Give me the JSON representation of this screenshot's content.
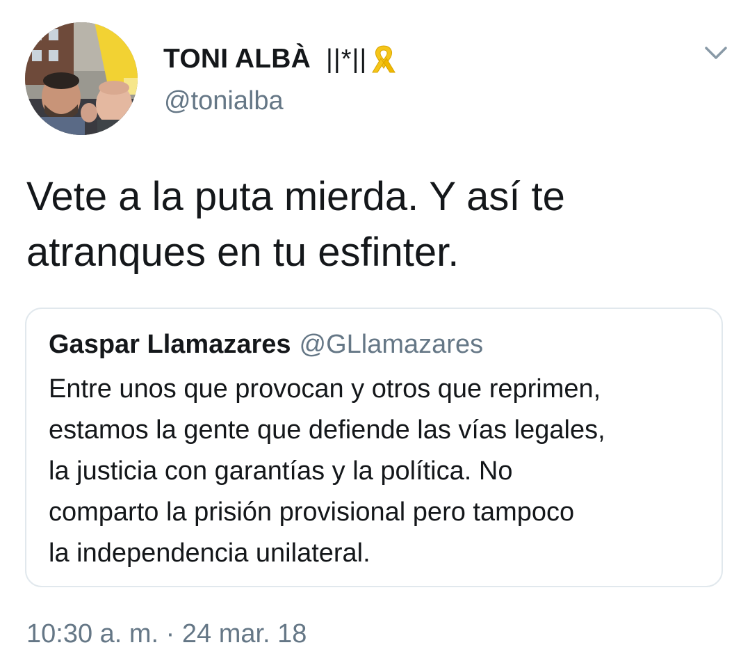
{
  "colors": {
    "text_primary": "#14171a",
    "text_secondary": "#657786",
    "border": "#e1e8ed",
    "ribbon": "#f5c518"
  },
  "author": {
    "display_name": "TONI ALBÀ",
    "name_symbols": "||*||",
    "badge_icon": "yellow-ribbon-icon",
    "handle": "@tonialba",
    "avatar_icon": "profile-photo"
  },
  "menu": {
    "icon": "chevron-down-icon"
  },
  "tweet": {
    "text_line1": "Vete a la puta mierda. Y así te",
    "text_line2": "atranques en tu esfinter."
  },
  "quoted_tweet": {
    "author_name": "Gaspar Llamazares",
    "author_handle": "@GLlamazares",
    "lines": [
      "Entre unos que provocan y otros que reprimen,",
      "estamos la gente que defiende las vías legales,",
      "la justicia con garantías y la política. No",
      "comparto la prisión provisional pero tampoco",
      "la independencia unilateral."
    ]
  },
  "timestamp": "10:30 a. m. · 24 mar. 18"
}
